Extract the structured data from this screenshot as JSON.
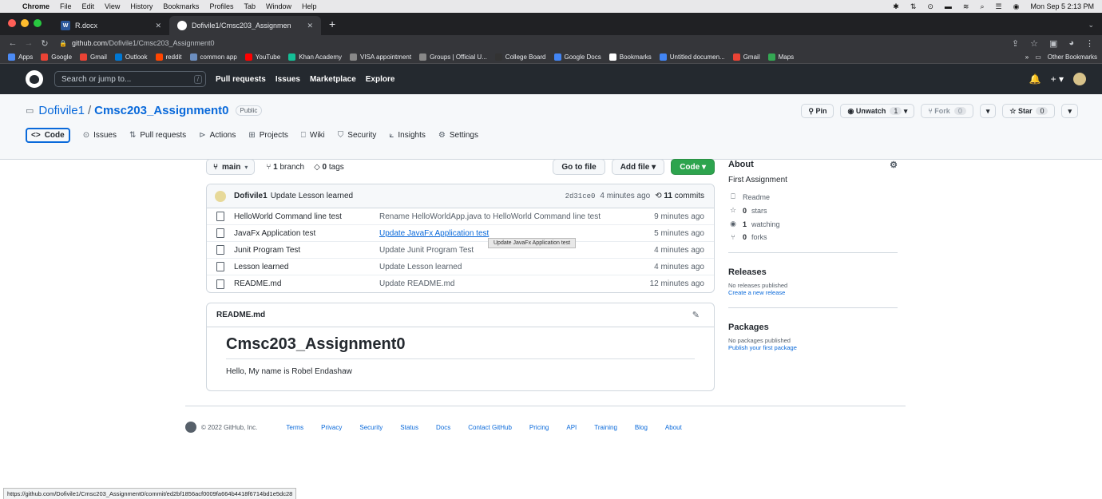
{
  "mac": {
    "menu": [
      "Chrome",
      "File",
      "Edit",
      "View",
      "History",
      "Bookmarks",
      "Profiles",
      "Tab",
      "Window",
      "Help"
    ],
    "clock": "Mon Sep 5  2:13 PM"
  },
  "tabs": [
    {
      "title": "R.docx",
      "icon": "word-icon",
      "active": false
    },
    {
      "title": "Dofivile1/Cmsc203_Assignmen",
      "icon": "github-icon",
      "active": true
    }
  ],
  "address": {
    "host": "github.com",
    "path": "/Dofivile1/Cmsc203_Assignment0"
  },
  "bookmarks": [
    {
      "label": "Apps",
      "color": "#4c8bf5"
    },
    {
      "label": "Google",
      "color": "#ea4335"
    },
    {
      "label": "Gmail",
      "color": "#ea4335"
    },
    {
      "label": "Outlook",
      "color": "#0078d4"
    },
    {
      "label": "reddit",
      "color": "#ff4500"
    },
    {
      "label": "common app",
      "color": "#6c8ebf"
    },
    {
      "label": "YouTube",
      "color": "#ff0000"
    },
    {
      "label": "Khan Academy",
      "color": "#14bf96"
    },
    {
      "label": "VISA appointment",
      "color": "#888888"
    },
    {
      "label": "Groups | Official U...",
      "color": "#888888"
    },
    {
      "label": "College Board",
      "color": "#333333"
    },
    {
      "label": "Google Docs",
      "color": "#4285f4"
    },
    {
      "label": "Bookmarks",
      "color": "#ffffff"
    },
    {
      "label": "Untitled documen...",
      "color": "#4285f4"
    },
    {
      "label": "Gmail",
      "color": "#ea4335"
    },
    {
      "label": "Maps",
      "color": "#34a853"
    }
  ],
  "other_bookmarks": "Other Bookmarks",
  "gh": {
    "search_placeholder": "Search or jump to...",
    "slash": "/",
    "nav": [
      "Pull requests",
      "Issues",
      "Marketplace",
      "Explore"
    ]
  },
  "repo": {
    "owner": "Dofivile1",
    "name": "Cmsc203_Assignment0",
    "visibility": "Public",
    "pin": "Pin",
    "unwatch": "Unwatch",
    "unwatch_count": "1",
    "fork": "Fork",
    "fork_count": "0",
    "star": "Star",
    "star_count": "0",
    "tabs": [
      "Code",
      "Issues",
      "Pull requests",
      "Actions",
      "Projects",
      "Wiki",
      "Security",
      "Insights",
      "Settings"
    ]
  },
  "toolbar": {
    "branch": "main",
    "branch_count": "1",
    "branch_label": "branch",
    "tag_count": "0",
    "tag_label": "tags",
    "go_to_file": "Go to file",
    "add_file": "Add file",
    "code": "Code"
  },
  "commit": {
    "author": "Dofivile1",
    "message": "Update Lesson learned",
    "sha": "2d31ce0",
    "time": "4 minutes ago",
    "count": "11",
    "count_label": "commits"
  },
  "files": [
    {
      "name": "HelloWorld Command line test",
      "message": "Rename HelloWorldApp.java to HelloWorld Command line test",
      "time": "9 minutes ago",
      "link": false
    },
    {
      "name": "JavaFx Application test",
      "message": "Update JavaFx Application test",
      "time": "5 minutes ago",
      "link": true
    },
    {
      "name": "Junit Program Test",
      "message": "Update Junit Program Test",
      "time": "4 minutes ago",
      "link": false
    },
    {
      "name": "Lesson learned",
      "message": "Update Lesson learned",
      "time": "4 minutes ago",
      "link": false
    },
    {
      "name": "README.md",
      "message": "Update README.md",
      "time": "12 minutes ago",
      "link": false
    }
  ],
  "tooltip": "Update JavaFx Application test",
  "readme": {
    "file": "README.md",
    "heading": "Cmsc203_Assignment0",
    "body": "Hello, My name is Robel Endashaw"
  },
  "about": {
    "title": "About",
    "description": "First Assignment",
    "readme": "Readme",
    "stars_n": "0",
    "stars": "stars",
    "watching_n": "1",
    "watching": "watching",
    "forks_n": "0",
    "forks": "forks"
  },
  "releases": {
    "title": "Releases",
    "none": "No releases published",
    "create": "Create a new release"
  },
  "packages": {
    "title": "Packages",
    "none": "No packages published",
    "publish": "Publish your first package"
  },
  "footer": {
    "copyright": "© 2022 GitHub, Inc.",
    "links": [
      "Terms",
      "Privacy",
      "Security",
      "Status",
      "Docs",
      "Contact GitHub",
      "Pricing",
      "API",
      "Training",
      "Blog",
      "About"
    ]
  },
  "status_url": "https://github.com/Dofivile1/Cmsc203_Assignment0/commit/ed2bf1856acf0009fa664b4418f6714bd1e5dc28"
}
